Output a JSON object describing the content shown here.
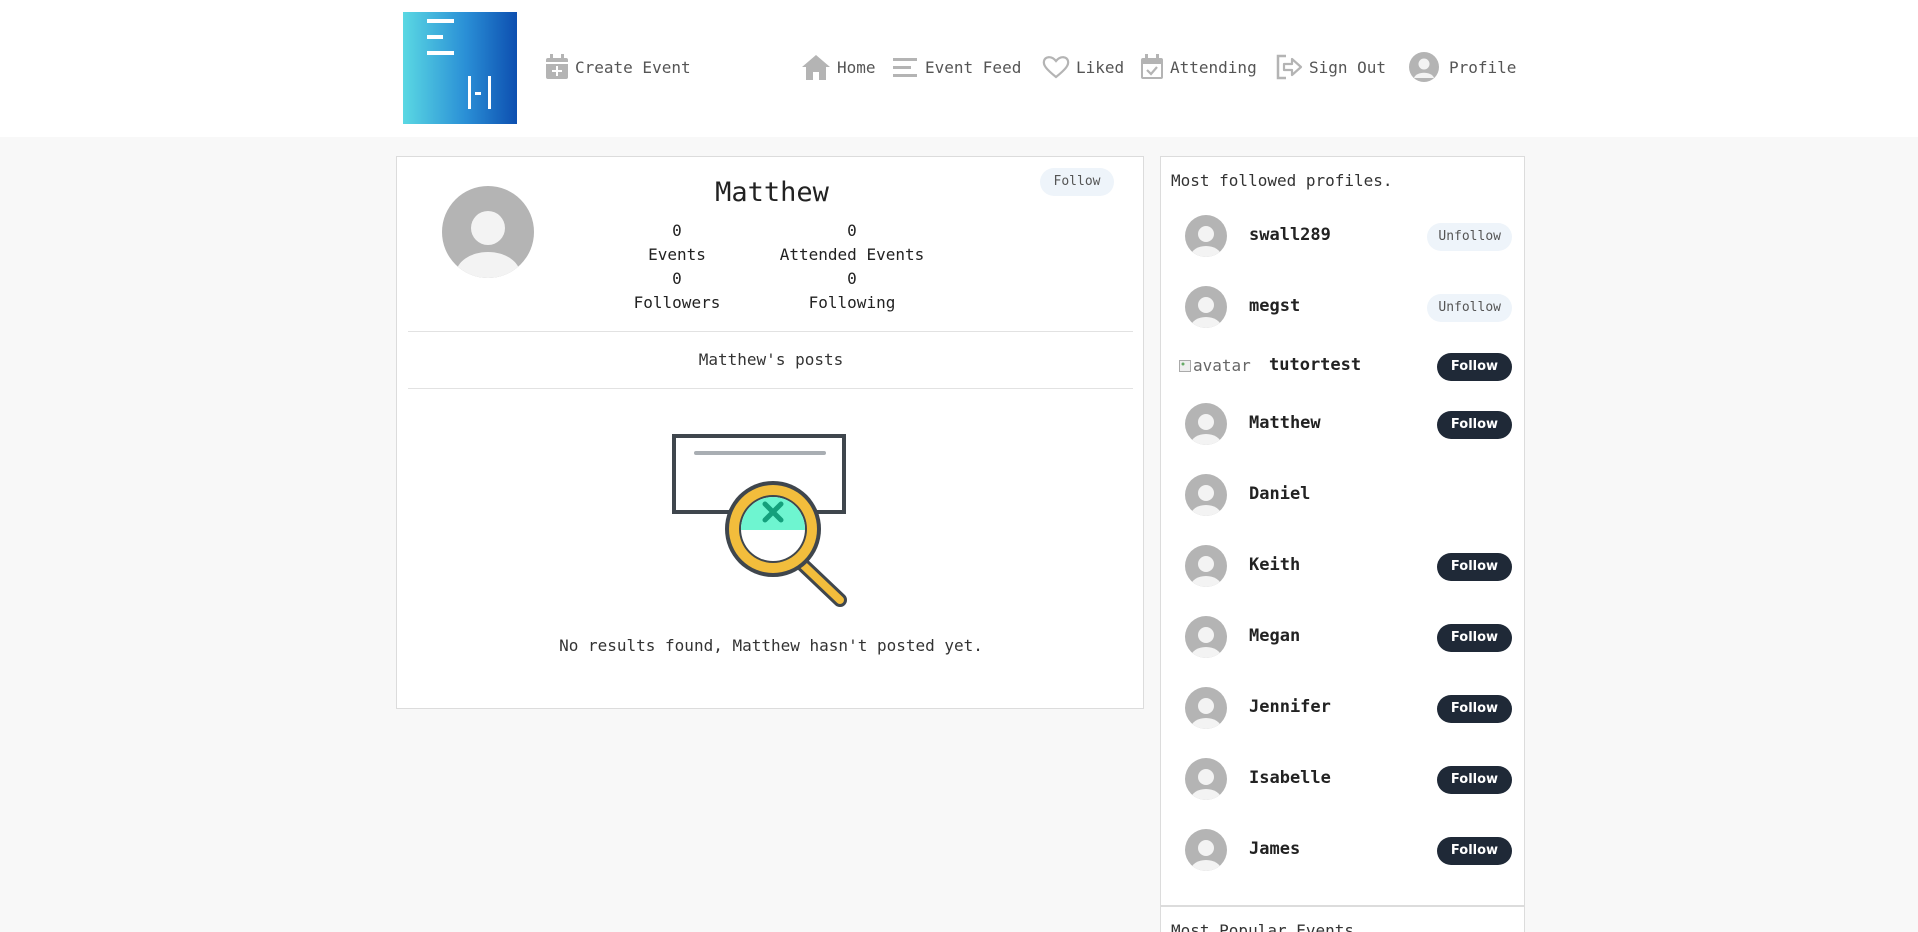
{
  "nav": {
    "create_event": "Create Event",
    "home": "Home",
    "event_feed": "Event Feed",
    "liked": "Liked",
    "attending": "Attending",
    "sign_out": "Sign Out",
    "profile": "Profile"
  },
  "profile": {
    "name": "Matthew",
    "follow_label": "Follow",
    "stats": [
      {
        "value": "0",
        "label": "Events"
      },
      {
        "value": "0",
        "label": "Attended Events"
      },
      {
        "value": "0",
        "label": "Followers"
      },
      {
        "value": "0",
        "label": "Following"
      }
    ],
    "posts_title": "Matthew's posts",
    "empty_message": "No results found, Matthew hasn't posted yet."
  },
  "sidebar": {
    "title": "Most followed profiles.",
    "profiles": [
      {
        "name": "swall289",
        "action": "Unfollow"
      },
      {
        "name": "megst",
        "action": "Unfollow"
      },
      {
        "name": "tutortest",
        "action": "Follow",
        "avatar_alt": "avatar"
      },
      {
        "name": "Matthew",
        "action": "Follow"
      },
      {
        "name": "Daniel",
        "action": ""
      },
      {
        "name": "Keith",
        "action": "Follow"
      },
      {
        "name": "Megan",
        "action": "Follow"
      },
      {
        "name": "Jennifer",
        "action": "Follow"
      },
      {
        "name": "Isabelle",
        "action": "Follow"
      },
      {
        "name": "James",
        "action": "Follow"
      }
    ],
    "popular_title": "Most Popular Events"
  },
  "colors": {
    "follow_bg": "#1f2937",
    "unfollow_bg": "#eef4fa",
    "logo_gradient_start": "#5ad8e3",
    "logo_gradient_end": "#0d4fb0"
  }
}
